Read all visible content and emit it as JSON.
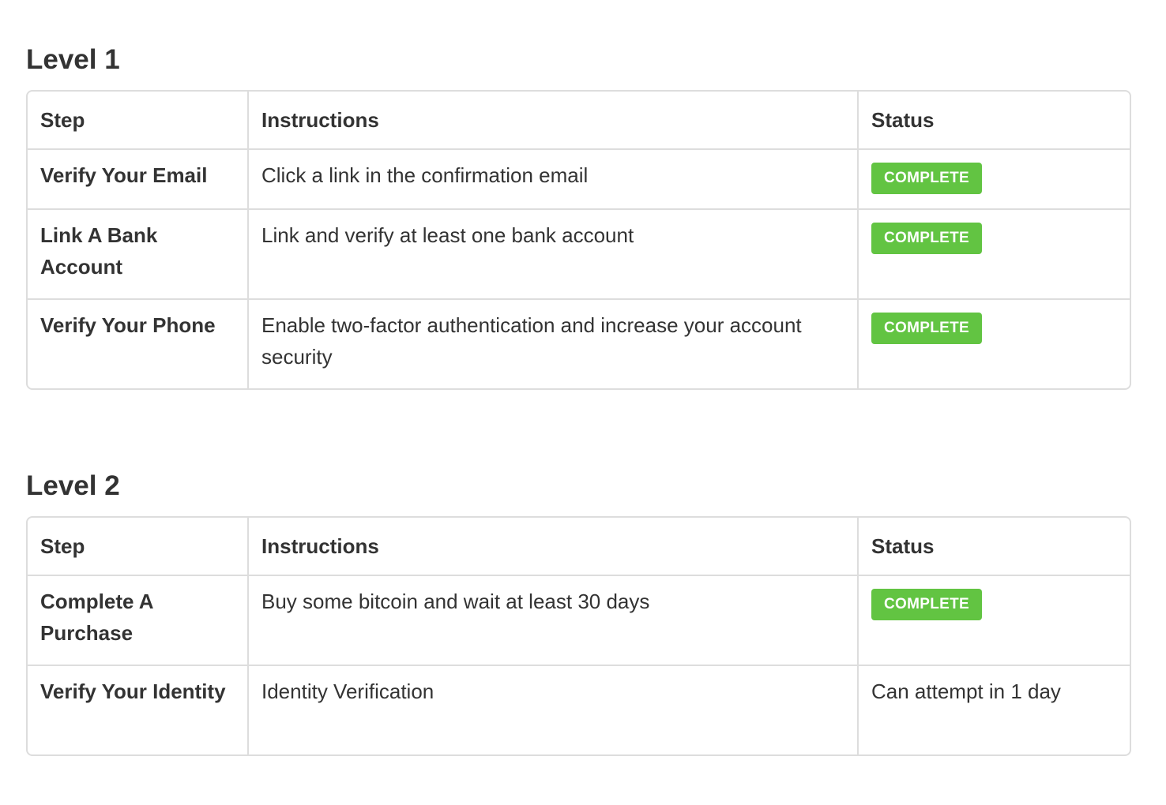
{
  "levels": [
    {
      "title": "Level 1",
      "headers": {
        "step": "Step",
        "instructions": "Instructions",
        "status": "Status"
      },
      "rows": [
        {
          "step": "Verify Your Email",
          "instructions": "Click a link in the confirmation email",
          "status": "COMPLETE"
        },
        {
          "step": "Link A Bank Account",
          "instructions": "Link and verify at least one bank account",
          "status": "COMPLETE"
        },
        {
          "step": "Verify Your Phone",
          "instructions": "Enable two-factor authentication and increase your account security",
          "status": "COMPLETE"
        }
      ]
    },
    {
      "title": "Level 2",
      "headers": {
        "step": "Step",
        "instructions": "Instructions",
        "status": "Status"
      },
      "rows": [
        {
          "step": "Complete A Purchase",
          "instructions": "Buy some bitcoin and wait at least 30 days",
          "status": "COMPLETE"
        },
        {
          "step": "Verify Your Identity",
          "instructions": "Identity Verification",
          "status_text": "Can attempt in 1 day"
        }
      ]
    }
  ],
  "colors": {
    "complete_badge": "#62c442",
    "border": "#dddddd",
    "text": "#333333"
  }
}
